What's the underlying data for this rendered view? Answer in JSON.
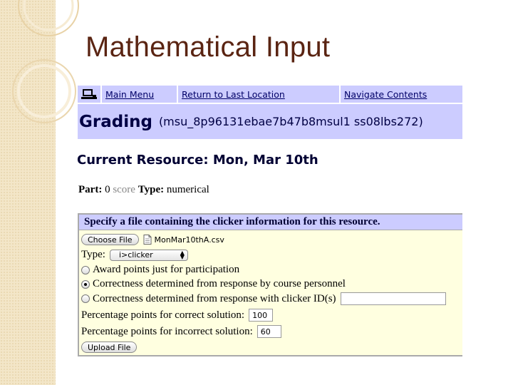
{
  "slide": {
    "title": "Mathematical Input"
  },
  "nav": {
    "icon": "computer-icon",
    "main_menu": "Main Menu",
    "return_last": "Return to Last Location",
    "navigate_contents": "Navigate Contents"
  },
  "grading": {
    "title": "Grading",
    "course_id": "(msu_8p96131ebae7b47b8msul1 ss08lbs272)"
  },
  "resource": {
    "heading": "Current Resource: Mon, Mar 10th"
  },
  "part": {
    "part_label": "Part:",
    "part_value": "0",
    "score_label": "score",
    "type_label": "Type:",
    "type_value": "numerical"
  },
  "form": {
    "header": "Specify a file containing the clicker information for this resource.",
    "choose_file_label": "Choose File",
    "file_icon": "document-icon",
    "file_name": "MonMar10thA.csv",
    "type_label": "Type:",
    "type_selected": "i>clicker",
    "radio_participation": "Award points just for participation",
    "radio_personnel": "Correctness determined from response by course personnel",
    "radio_clicker_id": "Correctness determined from response with clicker ID(s)",
    "clicker_id_value": "",
    "correct_label": "Percentage points for correct solution:",
    "correct_value": "100",
    "incorrect_label": "Percentage points for incorrect solution:",
    "incorrect_value": "60",
    "upload_label": "Upload File",
    "selected_option": "radio_personnel"
  }
}
